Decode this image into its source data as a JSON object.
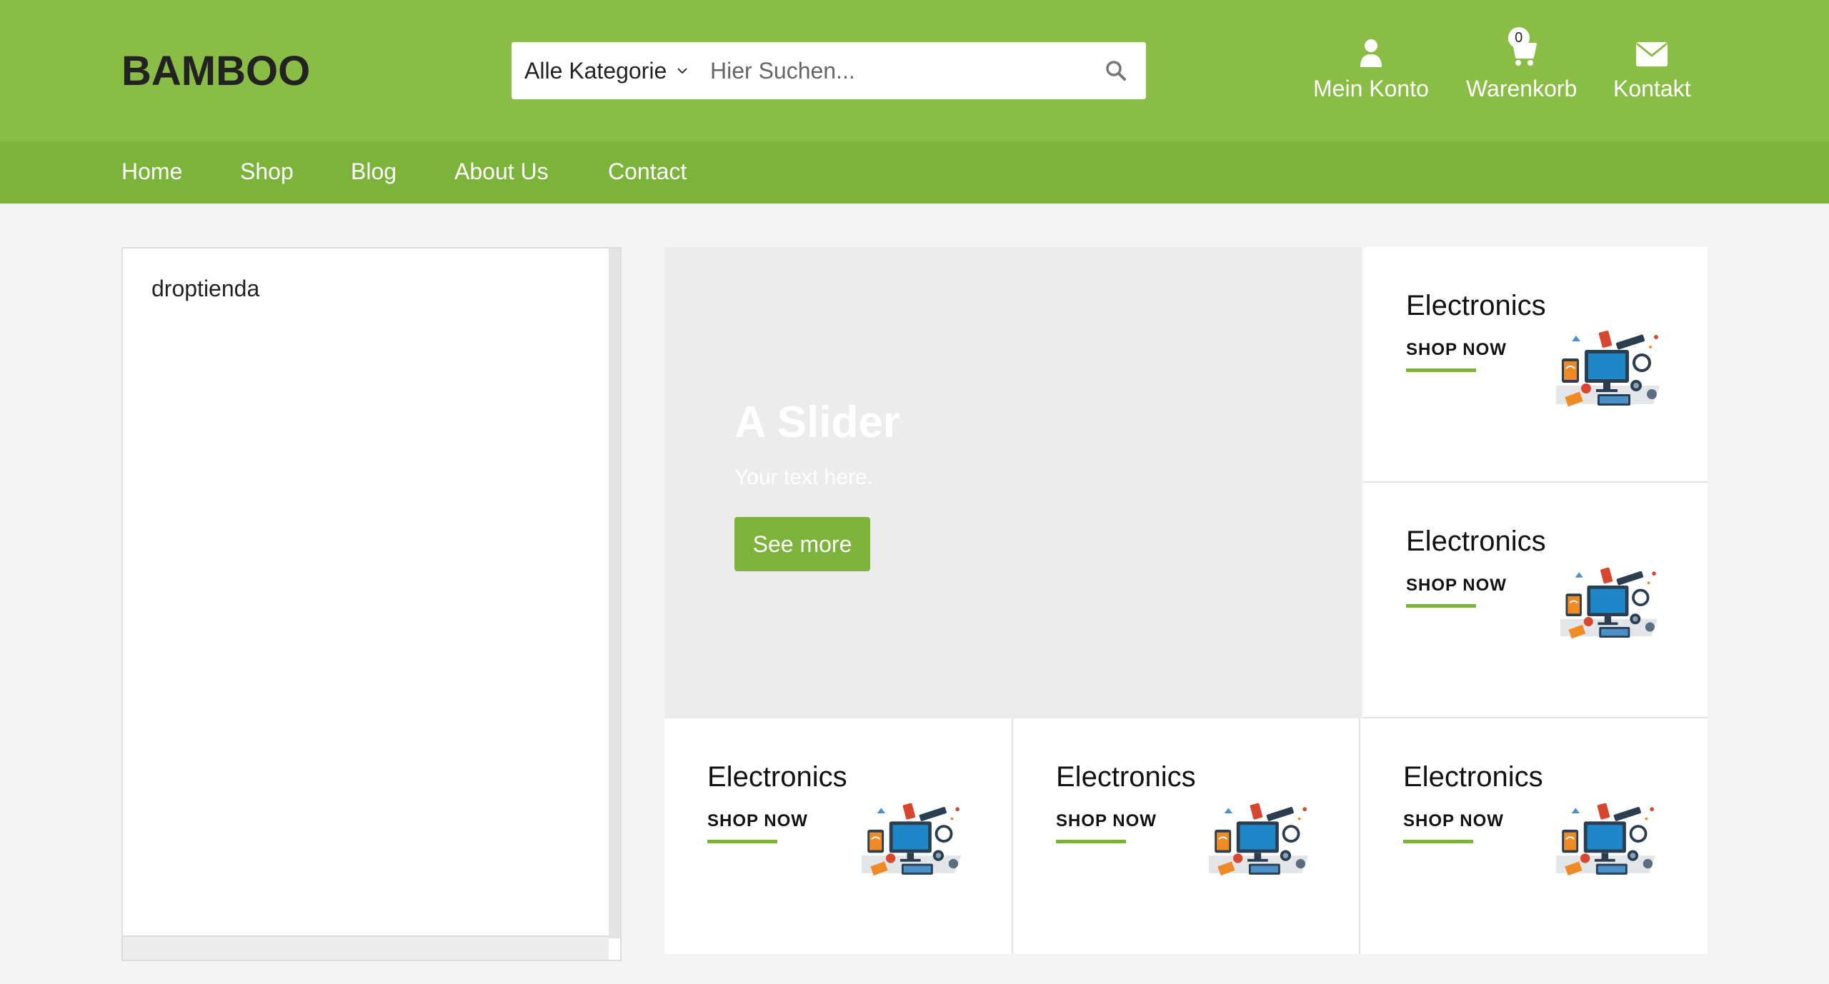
{
  "header": {
    "logo": "BAMBOO",
    "search": {
      "category": "Alle Kategorie",
      "placeholder": "Hier Suchen..."
    },
    "icons": [
      {
        "name": "user-icon",
        "label": "Mein Konto"
      },
      {
        "name": "cart-icon",
        "label": "Warenkorb",
        "badge": "0"
      },
      {
        "name": "envelope-icon",
        "label": "Kontakt"
      }
    ]
  },
  "nav": {
    "items": [
      "Home",
      "Shop",
      "Blog",
      "About Us",
      "Contact"
    ]
  },
  "left_panel": {
    "text": "droptienda"
  },
  "slider": {
    "title": "A Slider",
    "subtitle": "Your text here.",
    "button": "See more"
  },
  "cards": [
    {
      "title": "Electronics",
      "cta": "SHOP NOW"
    },
    {
      "title": "Electronics",
      "cta": "SHOP NOW"
    },
    {
      "title": "Electronics",
      "cta": "SHOP NOW"
    },
    {
      "title": "Electronics",
      "cta": "SHOP NOW"
    },
    {
      "title": "Electronics",
      "cta": "SHOP NOW"
    }
  ],
  "colors": {
    "header_bg": "#8abd45",
    "nav_bg": "#7cb33b",
    "accent": "#7cb33b",
    "page_bg": "#f4f4f4"
  }
}
